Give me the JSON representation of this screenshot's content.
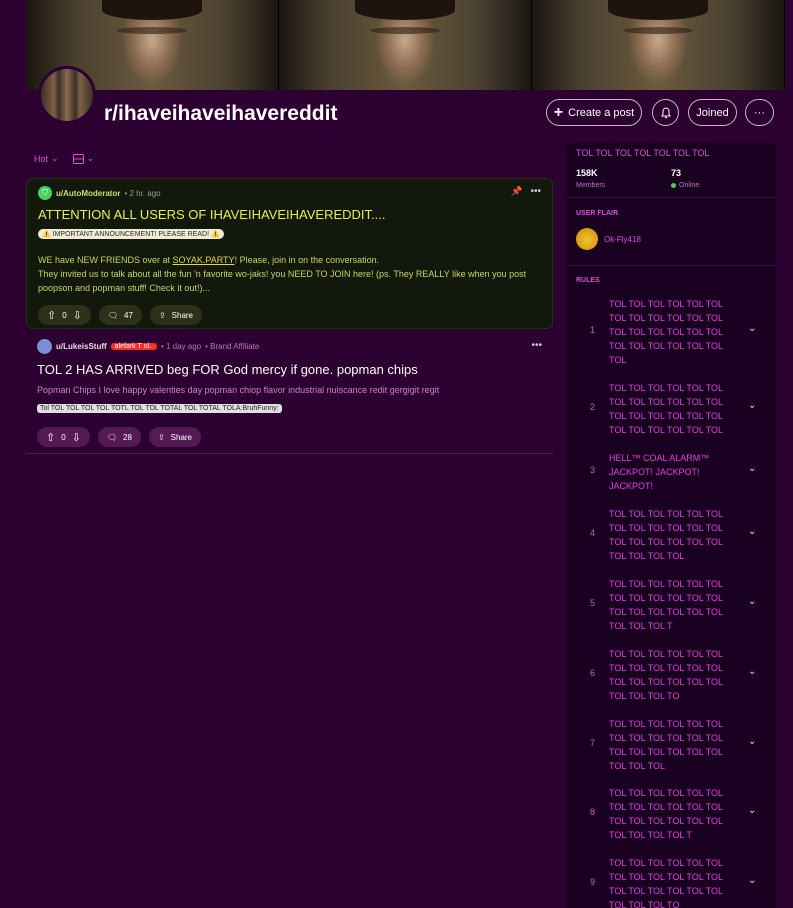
{
  "header": {
    "subreddit": "r/ihaveihaveihavereddit",
    "create_post": "Create a post",
    "joined": "Joined",
    "more": "···"
  },
  "sortbar": {
    "sort": "Hot"
  },
  "posts": [
    {
      "author": "u/AutoModerator",
      "time": "• 2 hr. ago",
      "title": "ATTENTION ALL USERS OF IHAVEIHAVEIHAVEREDDIT....",
      "flair": "⚠️ IMPORTANT ANNOUNCEMENT! PLEASE READ! ⚠️",
      "body_pre": "WE have NEW FRIENDS over at ",
      "body_link": "SOYAK.PARTY",
      "body_post": "! Please, join in on the conversation.",
      "body_line2": "They invited us to talk about all the fun 'n favorite wo-jaks! you NEED TO JOIN here! (ps. They REALLY like when you post poopson and popman stuff! Check it out!)...",
      "votes": "0",
      "comments": "47",
      "share": "Share"
    },
    {
      "author": "u/LukeisStuff",
      "user_flair": "alefark T ol..",
      "time": "• 1 day ago",
      "affiliate": "• Brand Affiliate",
      "title": "TOL 2 HAS ARRIVED beg FOR God mercy if gone. popman chips",
      "body": "Popman Chips I love happy valenties day popman chiop flavor industrial nuiscance redit gergigit regit",
      "flair": "Tol TOL TOL TOL TOL TOTL TOL TOL TOTAL TOL TOTAL TOLA:BruhFunny:",
      "votes": "0",
      "comments": "28",
      "share": "Share"
    }
  ],
  "sidebar": {
    "title": "TOL TOL TOL TOL TOL TOL TOL",
    "members_count": "158K",
    "members_label": "Members",
    "online_count": "73",
    "online_label": "Online",
    "user_flair_label": "USER FLAIR",
    "user_flair_name": "Ok-Fly418",
    "rules_label": "RULES",
    "rules": [
      {
        "n": "1",
        "text": "TOL TOL TOL TOL TOL TOL TOL TOL TOL TOL TOL TOL TOL TOL TOL TOL TOL TOL TOL TOL TOL TOL TOL TOL TOL"
      },
      {
        "n": "2",
        "text": "TOL TOL TOL TOL TOL TOL TOL TOL TOL TOL TOL TOL TOL TOL TOL TOL TOL TOL TOL TOL TOL TOL TOL TOL"
      },
      {
        "n": "3",
        "text": "HELL™ COAL ALARM™ JACKPOT! JACKPOT! JACKPOT!"
      },
      {
        "n": "4",
        "text": "TOL TOL TOL TOL TOL TOL TOL TOL TOL TOL TOL TOL TOL TOL TOL TOL TOL TOL TOL TOL TOL TOL"
      },
      {
        "n": "5",
        "text": "TOL TOL TOL TOL TOL TOL TOL TOL TOL TOL TOL TOL TOL TOL TOL TOL TOL TOL TOL TOL TOL T"
      },
      {
        "n": "6",
        "text": "TOL TOL TOL TOL TOL TOL TOL TOL TOL TOL TOL TOL TOL TOL TOL TOL TOL TOL TOL TOL TOL TO"
      },
      {
        "n": "7",
        "text": "TOL TOL TOL TOL TOL TOL TOL TOL TOL TOL TOL TOL TOL TOL TOL TOL TOL TOL TOL TOL TOL"
      },
      {
        "n": "8",
        "text": "TOL TOL TOL TOL TOL TOL TOL TOL TOL TOL TOL TOL TOL TOL TOL TOL TOL TOL TOL TOL TOL TOL T"
      },
      {
        "n": "9",
        "text": "TOL TOL TOL TOL TOL TOL TOL TOL TOL TOL TOL TOL TOL TOL TOL TOL TOL TOL TOL TOL TOL TO"
      }
    ]
  },
  "colors": {
    "background": "#2c0030",
    "accent": "#d94fd9",
    "announcement_title": "#e7f04a"
  }
}
